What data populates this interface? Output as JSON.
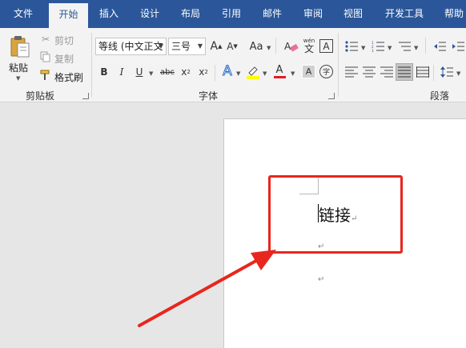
{
  "tabs": [
    {
      "label": "文件",
      "active": false
    },
    {
      "label": "开始",
      "active": true
    },
    {
      "label": "插入",
      "active": false
    },
    {
      "label": "设计",
      "active": false
    },
    {
      "label": "布局",
      "active": false
    },
    {
      "label": "引用",
      "active": false
    },
    {
      "label": "邮件",
      "active": false
    },
    {
      "label": "审阅",
      "active": false
    },
    {
      "label": "视图",
      "active": false
    },
    {
      "label": "开发工具",
      "active": false
    },
    {
      "label": "帮助",
      "active": false
    }
  ],
  "clipboard": {
    "paste_label": "粘贴",
    "cut_label": "剪切",
    "copy_label": "复制",
    "format_painter_label": "格式刷",
    "group_label": "剪贴板"
  },
  "font": {
    "font_name": "等线 (中文正文",
    "font_size": "三号",
    "group_label": "字体",
    "bold": "B",
    "italic": "I",
    "underline": "U",
    "strike": "abc",
    "subscript": "x",
    "superscript": "x",
    "grow": "A",
    "shrink": "A",
    "case": "Aa",
    "text_effect": "A",
    "font_color": "A",
    "char_border": "A",
    "phonetic_label": "wén",
    "phonetic_char": "文",
    "enclose": "字"
  },
  "paragraph": {
    "group_label": "段落"
  },
  "document": {
    "text": "链接",
    "para_mark": "↵"
  },
  "colors": {
    "brand": "#2b579a",
    "highlight_box": "#e8261d",
    "font_color_bar": "#e31b23",
    "highlight_bar": "#ffff00"
  }
}
